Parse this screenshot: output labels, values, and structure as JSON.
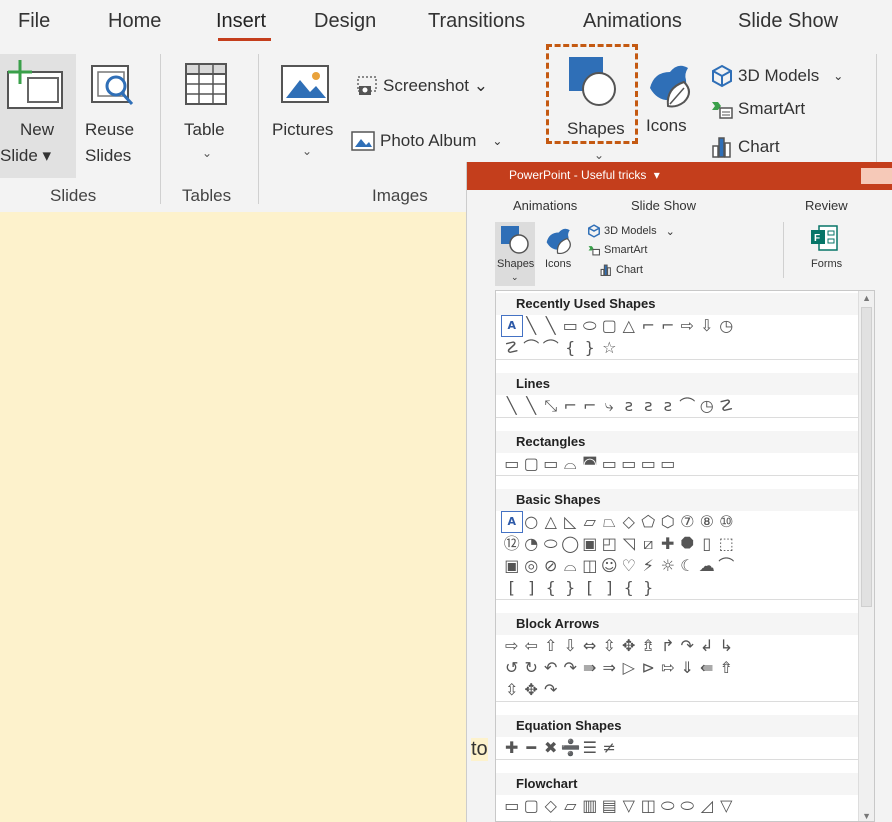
{
  "ribbon": {
    "tabs": [
      "File",
      "Home",
      "Insert",
      "Design",
      "Transitions",
      "Animations",
      "Slide Show"
    ],
    "active_tab": "Insert",
    "slides_group": {
      "new_label": "New",
      "new_sub": "Slide ▾",
      "reuse_label": "Reuse",
      "reuse_sub": "Slides",
      "group_label": "Slides"
    },
    "tables_group": {
      "table_label": "Table",
      "chev": "⌄",
      "group_label": "Tables"
    },
    "images_group": {
      "pictures_label": "Pictures",
      "chev": "⌄",
      "screenshot_label": "Screenshot ⌄",
      "photo_album_label": "Photo Album",
      "photo_album_chev": "⌄",
      "group_label": "Images"
    },
    "illustrations_group": {
      "shapes_label": "Shapes",
      "shapes_chev": "⌄",
      "icons_label": "Icons",
      "models_label": "3D Models",
      "models_chev": "⌄",
      "smartart_label": "SmartArt",
      "chart_label": "Chart"
    },
    "highlight_color": "#c45911"
  },
  "window": {
    "title": "PowerPoint - Useful tricks",
    "title_chev": "▾",
    "tabs": [
      "Animations",
      "Slide Show",
      "Review"
    ],
    "shapes_label": "Shapes",
    "shapes_chev": "⌄",
    "icons_label": "Icons",
    "models_label": "3D Models",
    "models_chev": "⌄",
    "smartart_label": "SmartArt",
    "chart_label": "Chart",
    "forms_label": "Forms"
  },
  "gallery": {
    "sections": [
      {
        "header": "Recently Used Shapes",
        "rows": [
          [
            "A",
            "╲",
            "╲",
            "▭",
            "⬭",
            "▢",
            "△",
            "⌐",
            "⌐",
            "⇨",
            "⇩",
            "◷"
          ],
          [
            "☡",
            "⌒",
            "⌒",
            "{",
            "}",
            "☆"
          ]
        ],
        "highlight_first": true
      },
      {
        "header": "Lines",
        "rows": [
          [
            "╲",
            "╲",
            "⤡",
            "⌐",
            "⌐",
            "⤷",
            "ƨ",
            "ƨ",
            "ƨ",
            "⌒",
            "◷",
            "☡"
          ]
        ]
      },
      {
        "header": "Rectangles",
        "rows": [
          [
            "▭",
            "▢",
            "▭",
            "⌓",
            "◚",
            "▭",
            "▭",
            "▭",
            "▭"
          ]
        ]
      },
      {
        "header": "Basic Shapes",
        "rows": [
          [
            "A",
            "○",
            "△",
            "◺",
            "▱",
            "⏢",
            "◇",
            "⬠",
            "⬡",
            "⑦",
            "⑧",
            "⑩"
          ],
          [
            "⑫",
            "◔",
            "⬭",
            "◯",
            "▣",
            "◰",
            "◹",
            "⧄",
            "✚",
            "⯃",
            "▯",
            "⬚"
          ],
          [
            "▣",
            "◎",
            "⊘",
            "⌓",
            "◫",
            "☺",
            "♡",
            "⚡",
            "☼",
            "☾",
            "☁",
            "⌒"
          ],
          [
            "[",
            "]",
            "{",
            "}",
            "[",
            "]",
            "{",
            "}"
          ]
        ],
        "highlight_first": true
      },
      {
        "header": "Block Arrows",
        "rows": [
          [
            "⇨",
            "⇦",
            "⇧",
            "⇩",
            "⇔",
            "⇳",
            "✥",
            "⇯",
            "↱",
            "↷",
            "↲",
            "↳"
          ],
          [
            "↺",
            "↻",
            "↶",
            "↷",
            "⇛",
            "⇒",
            "▷",
            "⊳",
            "⇰",
            "⇓",
            "⇚",
            "⇮"
          ],
          [
            "⇳",
            "✥",
            "↷"
          ]
        ]
      },
      {
        "header": "Equation Shapes",
        "rows": [
          [
            "✚",
            "━",
            "✖",
            "➗",
            "☰",
            "≠"
          ]
        ]
      },
      {
        "header": "Flowchart",
        "rows": [
          [
            "▭",
            "▢",
            "◇",
            "▱",
            "▥",
            "▤",
            "▽",
            "◫",
            "⬭",
            "⬭",
            "◿",
            "▽"
          ],
          [
            "○",
            "▿",
            "⬠",
            "▱",
            "⊗",
            "⊕",
            "⧗",
            "⬖",
            "△",
            "▽",
            "◖",
            "◗"
          ],
          [
            "◯",
            "⛁",
            "⓪",
            "⬭"
          ]
        ]
      }
    ]
  },
  "cut_text": "to"
}
